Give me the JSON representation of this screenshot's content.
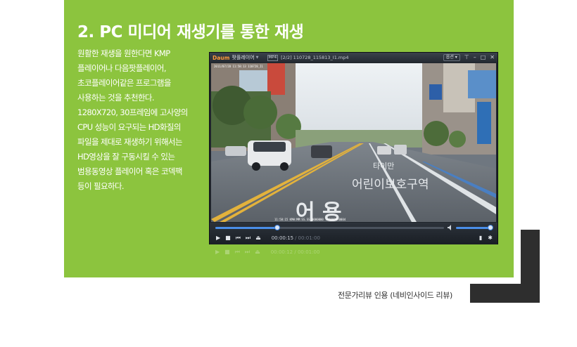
{
  "heading": "2. PC 미디어 재생기를 통한 재생",
  "description_lines": [
    "원활한 재생을 원한다면 KMP",
    "플레이어나 다음팟플레이어,",
    "초코플레이어같은 프로그램을",
    "사용하는 것을 추천한다.",
    "1280X720, 30프레임에 고사양의",
    "CPU 성능이 요구되는 HD화질의",
    "파일을 제대로 재생하기 위해서는",
    "HD영상을 잘 구동시킬 수 있는",
    "범용동영상 플레이어 혹은 코덱팩",
    "등이 필요하다."
  ],
  "player": {
    "logo": "Daum",
    "app_name": "팟플레이어",
    "format_badge": "MP4",
    "file_title": "[2/2] 110728_115813_I1.mp4",
    "option_label": "옵션",
    "seek_fraction": 0.27,
    "volume_fraction": 1.0,
    "time_current": "00:00:15",
    "time_total": "00:01:00",
    "reflection_time_current": "00:00:12",
    "reflection_time_total": "00:01:00"
  },
  "video": {
    "road_text_1": "타이만",
    "road_text_2": "어린이보호구역",
    "road_text_3": "어 용",
    "osd_top": "2011/07/28 11:58:13 110728_I1",
    "osd_bottom": "11:58:15 KMH:MM:SS.SS 0000000 :+00000:0004"
  },
  "caption": "전문가리뷰 인용 (네비인사이드 리뷰)",
  "colors": {
    "panel_green": "#8cc43e",
    "dark_bracket": "#2e2e2e",
    "accent_blue": "#4a8ee8"
  }
}
